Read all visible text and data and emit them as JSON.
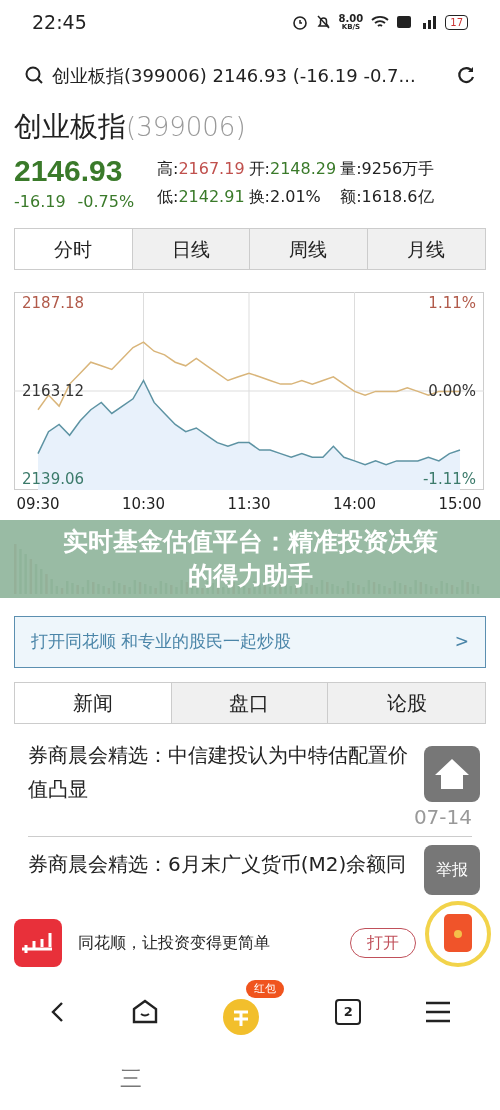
{
  "status_bar": {
    "time": "22:45",
    "net_speed": "8.00",
    "net_unit": "KB/S",
    "battery": "17"
  },
  "address_bar": {
    "text": "创业板指(399006) 2146.93 (-16.19 -0.7..."
  },
  "quote": {
    "name": "创业板指",
    "code": "(399006)",
    "price": "2146.93",
    "change": "-16.19",
    "change_pct": "-0.75%",
    "stats": [
      {
        "label": "高:",
        "value": "2167.19",
        "color": "#c0504d"
      },
      {
        "label": "开:",
        "value": "2148.29",
        "color": "#3a7a2a"
      },
      {
        "label": "量:",
        "value": "9256万手",
        "color": "#222222"
      },
      {
        "label": "低:",
        "value": "2142.91",
        "color": "#3a7a2a"
      },
      {
        "label": "换:",
        "value": "2.01%",
        "color": "#222222"
      },
      {
        "label": "额:",
        "value": "1618.6亿",
        "color": "#222222"
      }
    ]
  },
  "chart_tabs": [
    {
      "label": "分时",
      "selected": true
    },
    {
      "label": "日线",
      "selected": false
    },
    {
      "label": "周线",
      "selected": false
    },
    {
      "label": "月线",
      "selected": false
    }
  ],
  "chart": {
    "right_labels": [
      "1.11%",
      "0.00%",
      "-1.11%"
    ],
    "chart_data": {
      "type": "line",
      "grid": true,
      "ylim": [
        2136.05,
        2190.19
      ],
      "categories": [
        "09:30",
        null,
        null,
        null,
        null,
        null,
        null,
        null,
        null,
        null,
        "10:30",
        null,
        null,
        null,
        null,
        null,
        null,
        null,
        null,
        null,
        "11:30",
        null,
        null,
        null,
        null,
        null,
        null,
        null,
        null,
        null,
        "14:00",
        null,
        null,
        null,
        null,
        null,
        null,
        null,
        null,
        null,
        "15:00"
      ],
      "yticks": [
        {
          "value": 2187.18,
          "label": "2187.18"
        },
        {
          "value": 2163.12,
          "label": "2163.12"
        },
        {
          "value": 2139.06,
          "label": "2139.06"
        }
      ],
      "series": [
        {
          "color": "#d9b57a",
          "values": [
            2158,
            2162,
            2159,
            2165,
            2168,
            2171,
            2170,
            2169,
            2172,
            2175,
            2176.5,
            2174,
            2173,
            2171,
            2170,
            2172,
            2170,
            2168,
            2166,
            2167,
            2168,
            2167,
            2166,
            2165,
            2165,
            2166,
            2165,
            2166,
            2167,
            2165,
            2163,
            2162,
            2163,
            2163,
            2163,
            2164,
            2163,
            2162,
            2163,
            2163,
            2163
          ]
        },
        {
          "color": "#5d93a3",
          "values": [
            2146,
            2152,
            2154,
            2151,
            2155,
            2158,
            2160,
            2157,
            2159,
            2161,
            2166,
            2160,
            2157,
            2154,
            2152,
            2153,
            2151,
            2149,
            2148,
            2149,
            2149,
            2147,
            2147,
            2146,
            2145,
            2146,
            2145,
            2145,
            2148,
            2145,
            2144,
            2143,
            2144,
            2143,
            2144,
            2144,
            2144,
            2145,
            2144,
            2146,
            2147
          ]
        }
      ]
    }
  },
  "caption_banner": {
    "text": "实时基金估值平台：精准投资决策的得力助手"
  },
  "promo_link": {
    "text": "打开同花顺 和专业的股民一起炒股",
    "arrow": ">"
  },
  "news_tabs": [
    {
      "label": "新闻",
      "selected": true
    },
    {
      "label": "盘口",
      "selected": false
    },
    {
      "label": "论股",
      "selected": false
    }
  ],
  "news": [
    {
      "title": "券商晨会精选：中信建投认为中特估配置价值凸显",
      "date": "07-14"
    },
    {
      "title": "券商晨会精选：6月末广义货币(M2)余额同"
    }
  ],
  "floating": {
    "report": "举报"
  },
  "app_banner": {
    "text": "同花顺，让投资变得更简单",
    "button": "打开"
  },
  "bottom_nav": {
    "badge": "红包",
    "tab_count": "2"
  },
  "system_bar": {
    "menu": "三"
  }
}
